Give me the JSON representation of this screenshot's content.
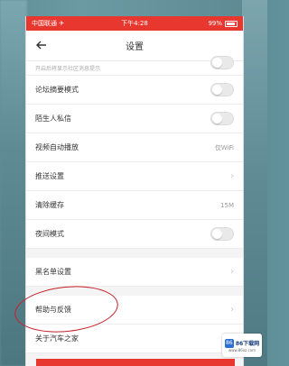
{
  "statusbar": {
    "carrier": "中国联通 ✈",
    "time": "下午4:28",
    "battery": "99%"
  },
  "navbar": {
    "title": "设置"
  },
  "settings": {
    "partial_label": "开启后将显示社区消息提示",
    "forum_summary": "论坛摘要模式",
    "stranger_dm": "陌生人私信",
    "video_autoplay": "视频自动播放",
    "video_autoplay_value": "仅WiFi",
    "push_settings": "推送设置",
    "clear_cache": "清除缓存",
    "cache_size": "15M",
    "night_mode": "夜间模式",
    "blacklist": "黑名单设置",
    "help_feedback": "帮助与反馈",
    "about": "关于汽车之家"
  },
  "watermark": {
    "brand": "86下载网",
    "sub": "www.86xz.com"
  },
  "colors": {
    "accent": "#e8372f",
    "annotation": "#c8202a"
  }
}
